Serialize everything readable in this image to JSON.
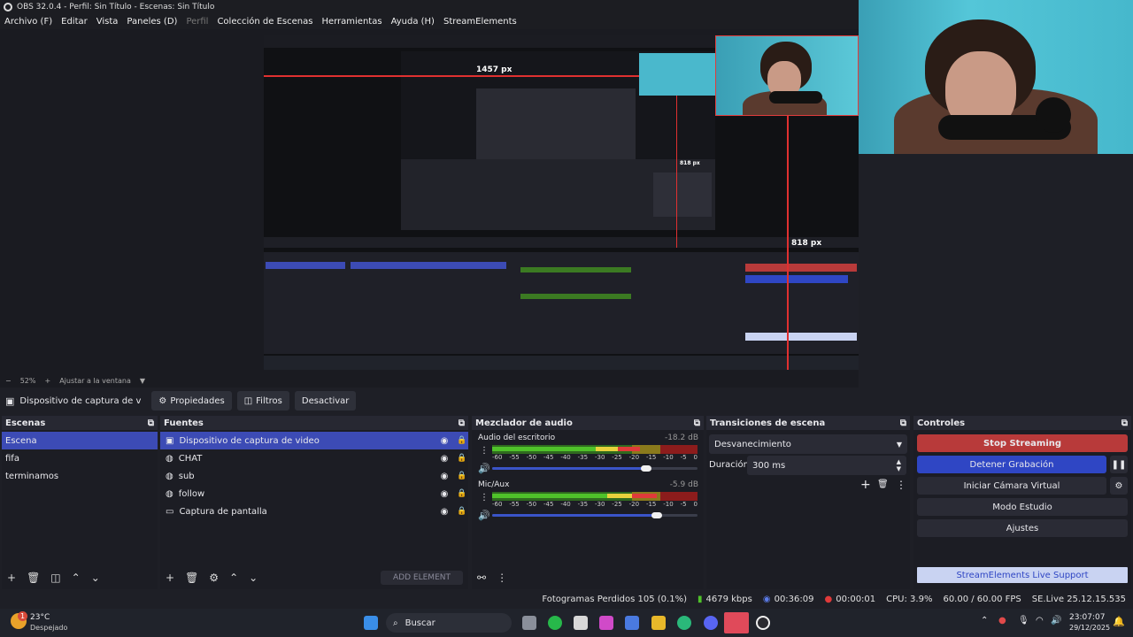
{
  "window": {
    "title": "OBS 32.0.4 - Perfil: Sin Título - Escenas: Sin Título"
  },
  "menu": [
    {
      "label": "Archivo (F)",
      "enabled": true
    },
    {
      "label": "Editar",
      "enabled": true
    },
    {
      "label": "Vista",
      "enabled": true
    },
    {
      "label": "Paneles (D)",
      "enabled": true
    },
    {
      "label": "Perfil",
      "enabled": false
    },
    {
      "label": "Colección de Escenas",
      "enabled": true
    },
    {
      "label": "Herramientas",
      "enabled": true
    },
    {
      "label": "Ayuda (H)",
      "enabled": true
    },
    {
      "label": "StreamElements",
      "enabled": true
    }
  ],
  "preview": {
    "px_label_top": "1457 px",
    "px_label_right": "818 px",
    "px_label_inner": "818 px"
  },
  "zoom": {
    "minus": "−",
    "percent": "52%",
    "plus": "+",
    "fit": "Ajustar a la ventana"
  },
  "source_toolbar": {
    "source_name": "Dispositivo de captura de v",
    "properties": "Propiedades",
    "filters": "Filtros",
    "deactivate": "Desactivar"
  },
  "scenes": {
    "title": "Escenas",
    "items": [
      "Escena",
      "fifa",
      "terminamos"
    ],
    "selected": 0
  },
  "sources": {
    "title": "Fuentes",
    "items": [
      {
        "name": "Dispositivo de captura de video",
        "icon": "camera-icon"
      },
      {
        "name": "CHAT",
        "icon": "browser-icon"
      },
      {
        "name": "sub",
        "icon": "browser-icon"
      },
      {
        "name": "follow",
        "icon": "browser-icon"
      },
      {
        "name": "Captura de pantalla",
        "icon": "monitor-icon"
      }
    ],
    "add_element": "ADD ELEMENT"
  },
  "mixer": {
    "title": "Mezclador de audio",
    "tracks": [
      {
        "name": "Audio del escritorio",
        "db": "-18.2 dB",
        "level": 0.72,
        "volume": 0.75
      },
      {
        "name": "Mic/Aux",
        "db": "-5.9 dB",
        "level": 0.8,
        "volume": 0.8
      }
    ],
    "ticks": [
      "-60",
      "-55",
      "-50",
      "-45",
      "-40",
      "-35",
      "-30",
      "-25",
      "-20",
      "-15",
      "-10",
      "-5",
      "0"
    ]
  },
  "transitions": {
    "title": "Transiciones de escena",
    "selected": "Desvanecimiento",
    "duration_label": "Duración",
    "duration_value": "300 ms"
  },
  "controls": {
    "title": "Controles",
    "stop_streaming": "Stop Streaming",
    "stop_recording": "Detener Grabación",
    "virtual_cam": "Iniciar Cámara Virtual",
    "studio_mode": "Modo Estudio",
    "settings": "Ajustes",
    "support": "StreamElements Live Support"
  },
  "status": {
    "dropped": "Fotogramas Perdidos 105 (0.1%)",
    "bitrate": "4679 kbps",
    "stream_time": "00:36:09",
    "rec_time": "00:00:01",
    "cpu": "CPU: 3.9%",
    "fps": "60.00 / 60.00 FPS",
    "version": "SE.Live 25.12.15.535"
  },
  "taskbar": {
    "weather_temp": "23°C",
    "weather_desc": "Despejado",
    "search": "Buscar",
    "time": "23:07:07",
    "date": "29/12/2025",
    "notif_badge": "1"
  },
  "colors": {
    "accent": "#3c4bb5",
    "stop_streaming": "#b83a3a",
    "stop_recording": "#2f46c4",
    "support_bg": "#c9d3f2"
  }
}
